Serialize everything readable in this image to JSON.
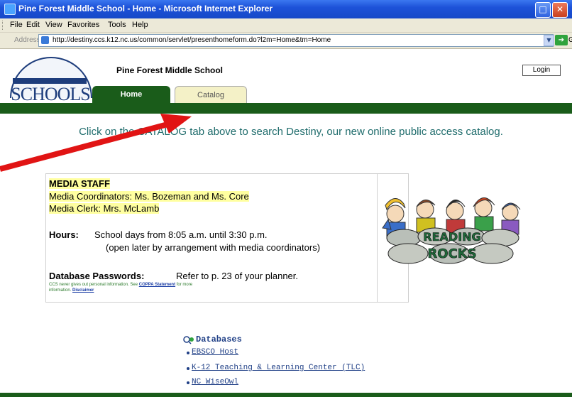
{
  "window": {
    "title": "Pine Forest Middle School - Home - Microsoft Internet Explorer",
    "max_glyph": "□",
    "close_glyph": "✕"
  },
  "menu": [
    "File",
    "Edit",
    "View",
    "Favorites",
    "Tools",
    "Help"
  ],
  "address": {
    "label": "Address",
    "url": "http://destiny.ccs.k12.nc.us/common/servlet/presenthomeform.do?l2m=Home&tm=Home",
    "go_label": "G"
  },
  "header": {
    "logo_text": "SCHOOLS",
    "school_name": "Pine Forest Middle School",
    "login_label": "Login"
  },
  "tabs": [
    {
      "label": "Home",
      "active": true
    },
    {
      "label": "Catalog",
      "active": false
    }
  ],
  "intro": {
    "text": "Click on the CATALOG tab above to search Destiny, our new online public access catalog."
  },
  "media": {
    "heading": "MEDIA STAFF",
    "coordinators": "Media Coordinators: Ms. Bozeman and Ms. Core",
    "clerk": "Media Clerk: Mrs. McLamb",
    "hours_label": "Hours:",
    "hours_text": "School days from 8:05 a.m. until 3:30 p.m.",
    "hours_note": "(open later by arrangement with media coordinators)",
    "db_label": "Database Passwords:",
    "db_text": "Refer to p. 23 of your planner.",
    "privacy_prefix": "CCS never gives out personal information. See",
    "coppa_link": "COPPA Statement",
    "privacy_suffix": "for more",
    "privacy_line2_prefix": "information.",
    "disclaimer_link": "Disclaimer"
  },
  "image": {
    "word1": "READING",
    "word2": "ROCKS"
  },
  "databases": {
    "heading": "Databases",
    "items": [
      "EBSCO Host",
      "K-12 Teaching & Learning Center (TLC)",
      "NC WiseOwl"
    ]
  },
  "colors": {
    "green": "#1a5c1a",
    "teal_text": "#1f6c6c",
    "highlight": "#ffffa0",
    "link_blue": "#1f3f86",
    "arrow_red": "#e11414"
  }
}
